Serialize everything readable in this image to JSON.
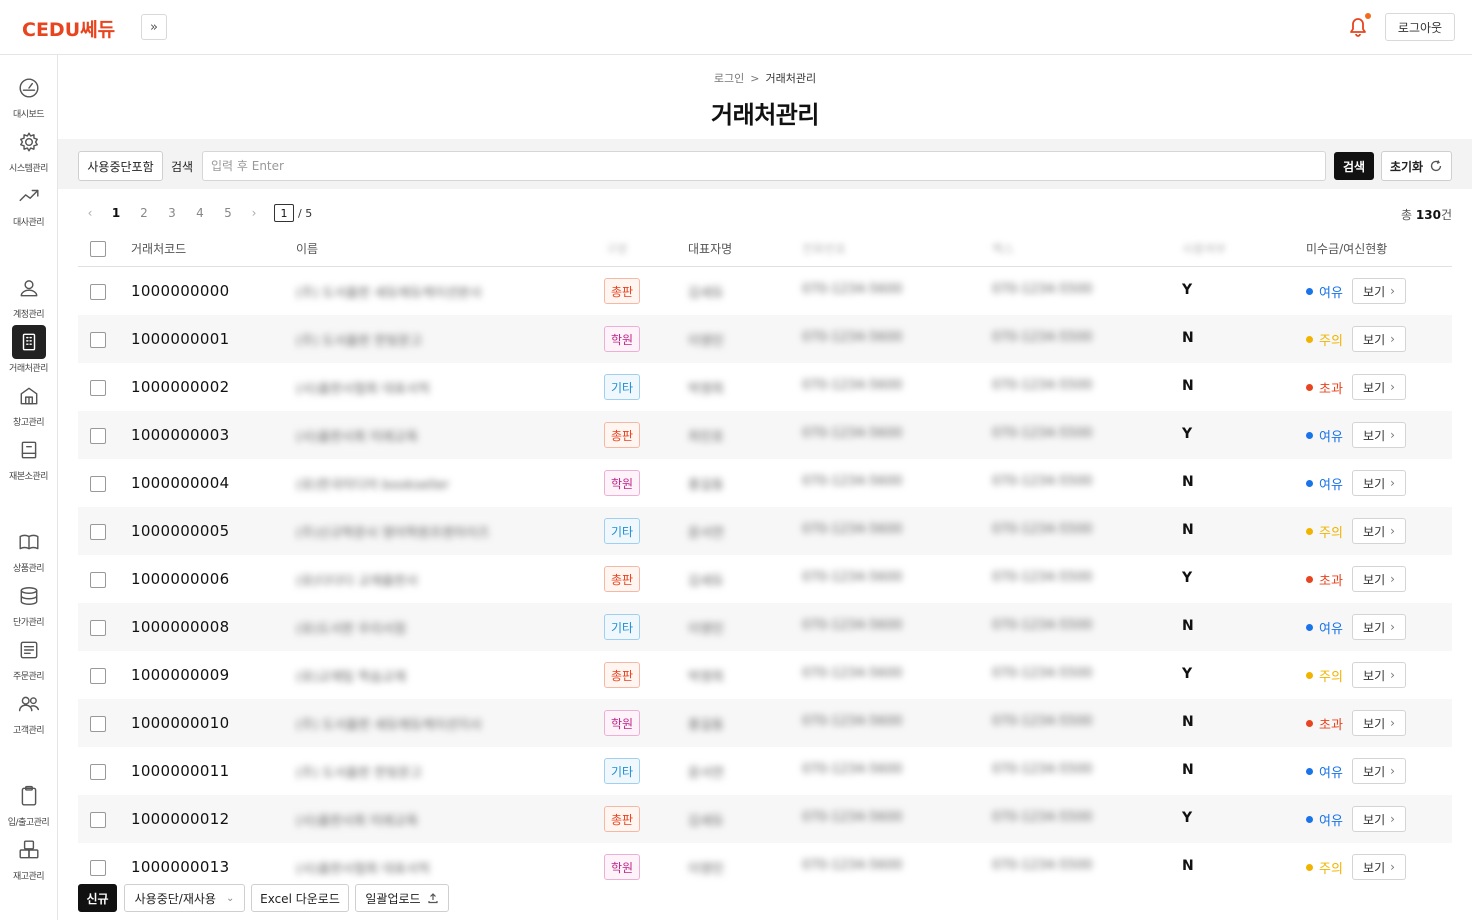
{
  "header": {
    "logo_text": "CEDU쎄듀",
    "collapse_glyph": "»",
    "logout_label": "로그아웃",
    "accent_color": "#e8441f"
  },
  "sidebar": {
    "items": [
      {
        "label": "대시보드",
        "icon": "dashboard-icon"
      },
      {
        "label": "시스템관리",
        "icon": "gear-icon"
      },
      {
        "label": "대사관리",
        "icon": "trending-up-icon"
      },
      {
        "label": "계정관리",
        "icon": "user-icon"
      },
      {
        "label": "거래처관리",
        "icon": "building-icon",
        "active": true
      },
      {
        "label": "창고관리",
        "icon": "warehouse-icon"
      },
      {
        "label": "재본소관리",
        "icon": "factory-icon"
      },
      {
        "label": "상품관리",
        "icon": "book-icon"
      },
      {
        "label": "단가관리",
        "icon": "database-icon"
      },
      {
        "label": "주문관리",
        "icon": "list-icon"
      },
      {
        "label": "고객관리",
        "icon": "users-icon"
      },
      {
        "label": "입/출고관리",
        "icon": "clipboard-icon"
      },
      {
        "label": "재고관리",
        "icon": "boxes-icon"
      }
    ]
  },
  "breadcrumb": {
    "home": "로그인",
    "sep": ">",
    "current": "거래처관리"
  },
  "page_title": "거래처관리",
  "search": {
    "include_inactive_label": "사용중단포함",
    "label": "검색",
    "placeholder": "입력 후 Enter",
    "search_button": "검색",
    "reset_button": "초기화"
  },
  "pager": {
    "pages": [
      "1",
      "2",
      "3",
      "4",
      "5"
    ],
    "current": "1",
    "total_pages": "/ 5"
  },
  "total": {
    "prefix": "총 ",
    "count": "130",
    "suffix": "건"
  },
  "table": {
    "headers": {
      "code": "거래처코드",
      "name": "이름",
      "type": "구분",
      "ceo": "대표자명",
      "phone": "전화번호",
      "fax": "팩스",
      "used": "사용여부",
      "credit": "미수금/여신현황"
    },
    "rows": [
      {
        "code": "1000000000",
        "name": "(주) 도서출판 세듀에듀케이션본사",
        "type": "총판",
        "ceo": "김세듀",
        "phone": "070-1234-5600",
        "fax": "070-1234-5500",
        "used": "Y",
        "status": "여유"
      },
      {
        "code": "1000000001",
        "name": "(주) 도서출판 한빛문고",
        "type": "학원",
        "ceo": "이영민",
        "phone": "070-1234-5600",
        "fax": "070-1234-5500",
        "used": "N",
        "status": "주의"
      },
      {
        "code": "1000000002",
        "name": "(사)출판사협회 대표서적",
        "type": "기타",
        "ceo": "박영희",
        "phone": "070-1234-5600",
        "fax": "070-1234-5500",
        "used": "N",
        "status": "초과"
      },
      {
        "code": "1000000003",
        "name": "(사)출판사회 미래교육",
        "type": "총판",
        "ceo": "최민호",
        "phone": "070-1234-5600",
        "fax": "070-1234-5500",
        "used": "Y",
        "status": "여유"
      },
      {
        "code": "1000000004",
        "name": "(유)한국미디어 bookseller",
        "type": "학원",
        "ceo": "홍길동",
        "phone": "070-1234-5600",
        "fax": "070-1234-5500",
        "used": "N",
        "status": "여유"
      },
      {
        "code": "1000000005",
        "name": "(주)신규학문사 영어학원프랜차이즈",
        "type": "기타",
        "ceo": "윤서연",
        "phone": "070-1234-5600",
        "fax": "070-1234-5500",
        "used": "N",
        "status": "주의"
      },
      {
        "code": "1000000006",
        "name": "(유)다다다 교재출판사",
        "type": "총판",
        "ceo": "김세듀",
        "phone": "070-1234-5600",
        "fax": "070-1234-5500",
        "used": "Y",
        "status": "초과"
      },
      {
        "code": "1000000008",
        "name": "(유)도서판 우리서점",
        "type": "기타",
        "ceo": "이영민",
        "phone": "070-1234-5600",
        "fax": "070-1234-5500",
        "used": "N",
        "status": "여유"
      },
      {
        "code": "1000000009",
        "name": "(유)교재팀 학습교재",
        "type": "총판",
        "ceo": "박영희",
        "phone": "070-1234-5600",
        "fax": "070-1234-5500",
        "used": "Y",
        "status": "주의"
      },
      {
        "code": "1000000010",
        "name": "(주) 도서출판 세듀에듀케이션지사",
        "type": "학원",
        "ceo": "홍길동",
        "phone": "070-1234-5600",
        "fax": "070-1234-5500",
        "used": "N",
        "status": "초과"
      },
      {
        "code": "1000000011",
        "name": "(주) 도서출판 한빛문고",
        "type": "기타",
        "ceo": "윤서연",
        "phone": "070-1234-5600",
        "fax": "070-1234-5500",
        "used": "N",
        "status": "여유"
      },
      {
        "code": "1000000012",
        "name": "(사)출판사회 미래교육",
        "type": "총판",
        "ceo": "김세듀",
        "phone": "070-1234-5600",
        "fax": "070-1234-5500",
        "used": "Y",
        "status": "여유"
      },
      {
        "code": "1000000013",
        "name": "(사)출판사협회 대표서적",
        "type": "학원",
        "ceo": "이영민",
        "phone": "070-1234-5600",
        "fax": "070-1234-5500",
        "used": "N",
        "status": "주의"
      }
    ],
    "view_label": "보기"
  },
  "tag_styles": {
    "총판": {
      "color": "#e8441f",
      "border": "#f5b8a4",
      "bg": "#fff5f1"
    },
    "학원": {
      "color": "#c0268c",
      "border": "#ecb0d6",
      "bg": "#fdf3f9"
    },
    "기타": {
      "color": "#1c8fd6",
      "border": "#9fd0ef",
      "bg": "#f1f8fd"
    }
  },
  "status_colors": {
    "여유": "#1a73e8",
    "주의": "#f0b400",
    "초과": "#e8441f"
  },
  "footer": {
    "new_label": "신규",
    "toggle_label": "사용중단/재사용",
    "excel_label": "Excel 다운로드",
    "upload_label": "일괄업로드"
  }
}
